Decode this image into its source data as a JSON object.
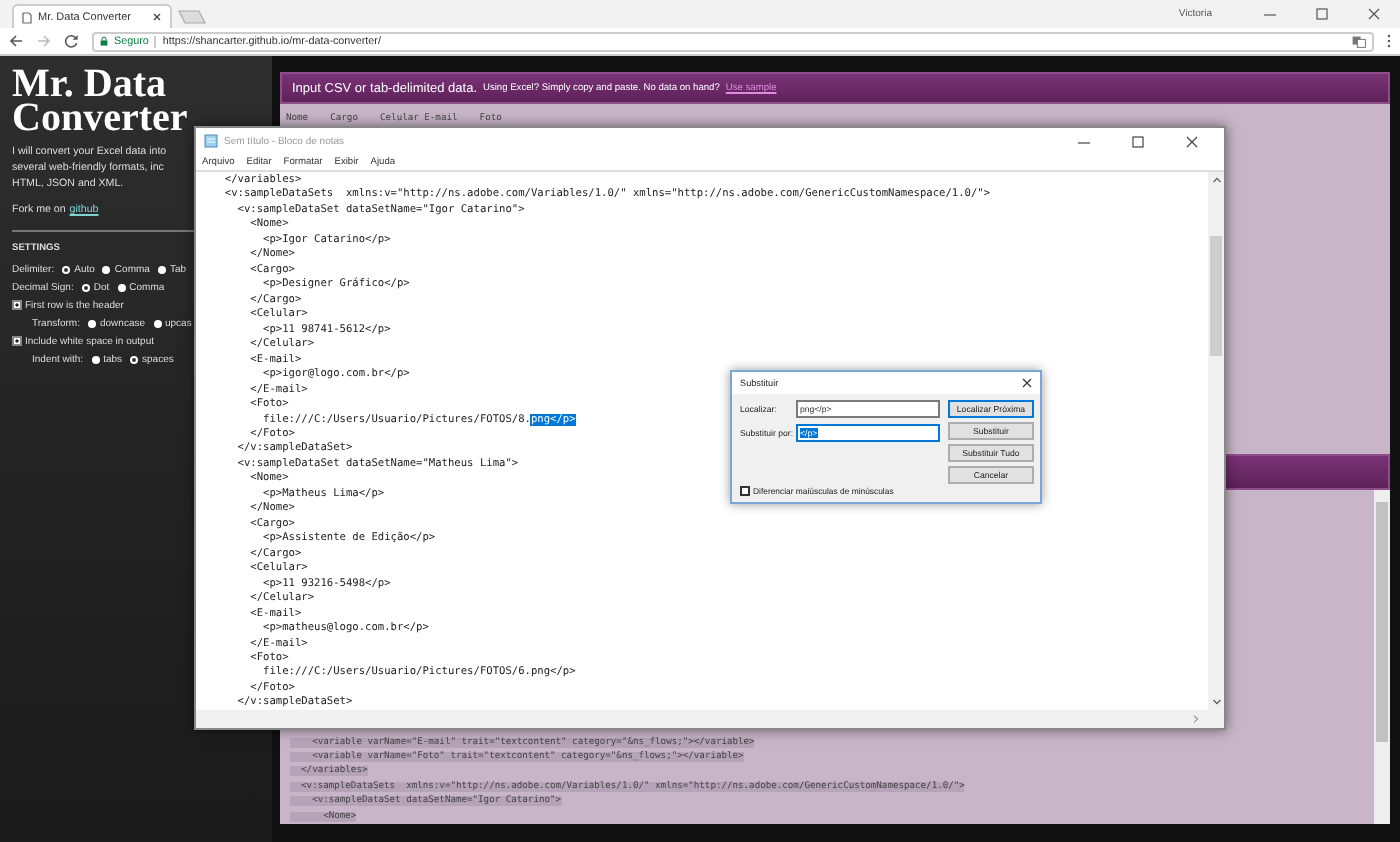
{
  "browser": {
    "tabs": [
      {
        "title": "Mr. Data Converter",
        "selected": true
      }
    ],
    "user": "Victoria",
    "security": "Seguro",
    "url": "https://shancarter.github.io/mr-data-converter/"
  },
  "page": {
    "title": "Mr. Data Converter",
    "intro": [
      "I will convert your Excel data into",
      "several web-friendly formats, inc",
      "HTML, JSON and XML."
    ],
    "fork": {
      "text": "Fork me on",
      "link": "github"
    },
    "settings_heading": "SETTINGS",
    "settings": [
      {
        "kind": "radios",
        "label": "Delimiter:",
        "options": [
          {
            "label": "Auto",
            "selected": true
          },
          {
            "label": "Comma",
            "selected": false
          },
          {
            "label": "Tab",
            "selected": false
          }
        ]
      },
      {
        "kind": "radios",
        "label": "Decimal Sign:",
        "options": [
          {
            "label": "Dot",
            "selected": true
          },
          {
            "label": "Comma",
            "selected": false
          }
        ]
      },
      {
        "kind": "checkbox",
        "label": "First row is the header",
        "checked": true
      },
      {
        "kind": "subradios",
        "label": "Transform:",
        "options": [
          {
            "label": "downcase",
            "selected": false
          },
          {
            "label": "upcas",
            "selected": false
          }
        ]
      },
      {
        "kind": "checkbox",
        "label": "Include white space in output",
        "checked": true
      },
      {
        "kind": "subradios",
        "label": "Indent with:",
        "options": [
          {
            "label": "tabs",
            "selected": false
          },
          {
            "label": "spaces",
            "selected": true
          }
        ]
      }
    ],
    "input_header": {
      "title": "Input CSV or tab-delimited data.",
      "hint": "Using Excel? Simply copy and paste. No data on hand?",
      "link": "Use sample"
    },
    "input_text": "Nome    Cargo    Celular E-mail    Foto",
    "output_lines": [
      {
        "text": "    <variable varName=\"E-mail\" trait=\"textcontent\" category=\"&ns_flows;\"></variable>",
        "selected": true
      },
      {
        "text": "    <variable varName=\"Foto\" trait=\"textcontent\" category=\"&ns_flows;\"></variable>",
        "selected": true
      },
      {
        "text": "  </variables>",
        "selected": true
      },
      {
        "text": "  <v:sampleDataSets  xmlns:v=\"http://ns.adobe.com/Variables/1.0/\" xmlns=\"http://ns.adobe.com/GenericCustomNamespace/1.0/\">",
        "selected": true
      },
      {
        "text": "    <v:sampleDataSet dataSetName=\"Igor Catarino\">",
        "selected": true
      },
      {
        "text": "      <Nome>",
        "selected": true
      }
    ]
  },
  "notepad": {
    "title": "Sem título - Bloco de notas",
    "menu": [
      "Arquivo",
      "Editar",
      "Formatar",
      "Exibir",
      "Ajuda"
    ],
    "lines": [
      {
        "text": "  </variables>"
      },
      {
        "text": "  <v:sampleDataSets  xmlns:v=\"http://ns.adobe.com/Variables/1.0/\" xmlns=\"http://ns.adobe.com/GenericCustomNamespace/1.0/\">"
      },
      {
        "text": "    <v:sampleDataSet dataSetName=\"Igor Catarino\">"
      },
      {
        "text": "      <Nome>"
      },
      {
        "text": "        <p>Igor Catarino</p>"
      },
      {
        "text": "      </Nome>"
      },
      {
        "text": "      <Cargo>"
      },
      {
        "text": "        <p>Designer Gráfico</p>"
      },
      {
        "text": "      </Cargo>"
      },
      {
        "text": "      <Celular>"
      },
      {
        "text": "        <p>11 98741-5612</p>"
      },
      {
        "text": "      </Celular>"
      },
      {
        "text": "      <E-mail>"
      },
      {
        "text": "        <p>igor@logo.com.br</p>"
      },
      {
        "text": "      </E-mail>"
      },
      {
        "text": "      <Foto>"
      },
      {
        "text": "        file:///C:/Users/Usuario/Pictures/FOTOS/8.",
        "selected_text": "png</p>"
      },
      {
        "text": "      </Foto>"
      },
      {
        "text": "    </v:sampleDataSet>"
      },
      {
        "text": "    <v:sampleDataSet dataSetName=\"Matheus Lima\">"
      },
      {
        "text": "      <Nome>"
      },
      {
        "text": "        <p>Matheus Lima</p>"
      },
      {
        "text": "      </Nome>"
      },
      {
        "text": "      <Cargo>"
      },
      {
        "text": "        <p>Assistente de Edição</p>"
      },
      {
        "text": "      </Cargo>"
      },
      {
        "text": "      <Celular>"
      },
      {
        "text": "        <p>11 93216-5498</p>"
      },
      {
        "text": "      </Celular>"
      },
      {
        "text": "      <E-mail>"
      },
      {
        "text": "        <p>matheus@logo.com.br</p>"
      },
      {
        "text": "      </E-mail>"
      },
      {
        "text": "      <Foto>"
      },
      {
        "text": "        file:///C:/Users/Usuario/Pictures/FOTOS/6.png</p>"
      },
      {
        "text": "      </Foto>"
      },
      {
        "text": "    </v:sampleDataSet>"
      }
    ]
  },
  "dialog": {
    "title": "Substituir",
    "fields": [
      {
        "label": "Localizar:",
        "value": "png</p>",
        "value_selected": false
      },
      {
        "label": "Substituir por:",
        "value": "</p>",
        "value_selected": true
      }
    ],
    "buttons": [
      {
        "label": "Localizar Próxima",
        "default": true
      },
      {
        "label": "Substituir",
        "default": false
      },
      {
        "label": "Substituir Tudo",
        "default": false
      },
      {
        "label": "Cancelar",
        "default": false
      }
    ],
    "option": {
      "label": "Diferenciar maiúsculas de minúsculas",
      "checked": false
    }
  }
}
